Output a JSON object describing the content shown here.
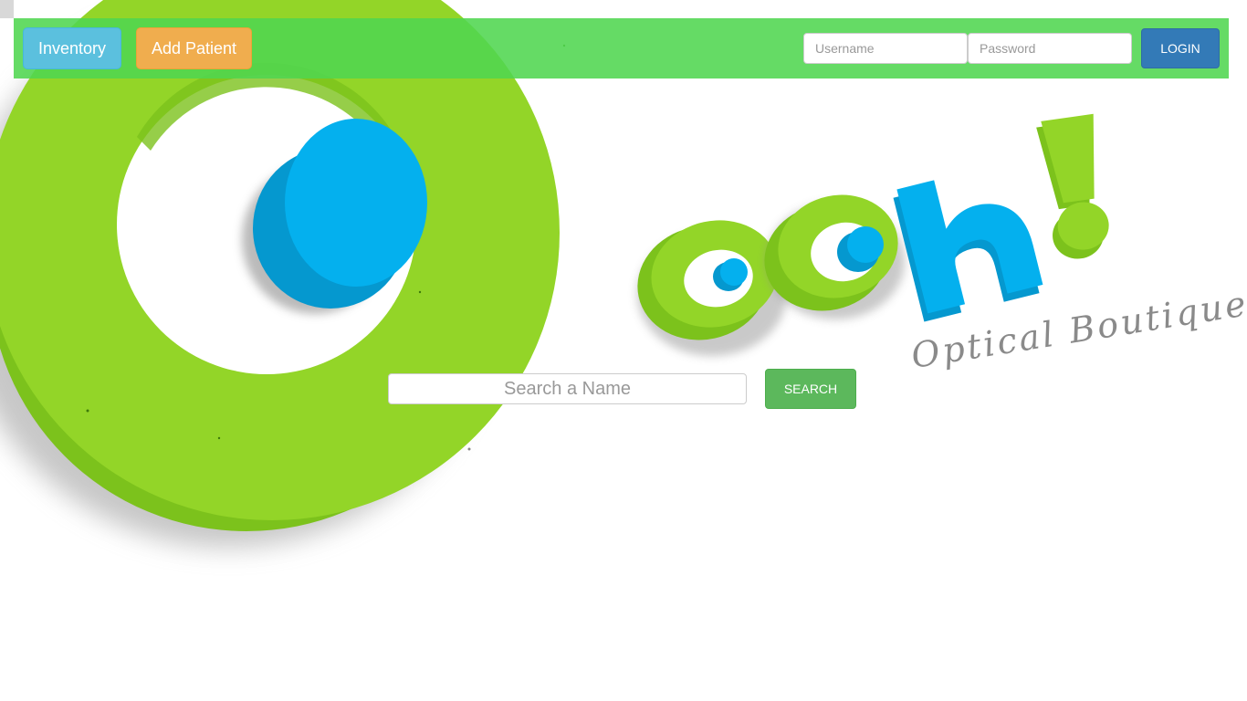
{
  "navbar": {
    "inventory_label": "Inventory",
    "add_patient_label": "Add Patient",
    "username_placeholder": "Username",
    "password_placeholder": "Password",
    "login_label": "LOGIN"
  },
  "search": {
    "placeholder": "Search a Name",
    "button_label": "SEARCH"
  },
  "brand": {
    "logo_text": "ooh!",
    "tagline": "Optical Boutique"
  },
  "colors": {
    "navbar_green": "#50d650",
    "inventory_button": "#5bc0de",
    "add_patient_button": "#f0ad4e",
    "login_button": "#337ab7",
    "search_button": "#5cb85c",
    "logo_green": "#93d528",
    "logo_blue": "#04b0ee"
  }
}
